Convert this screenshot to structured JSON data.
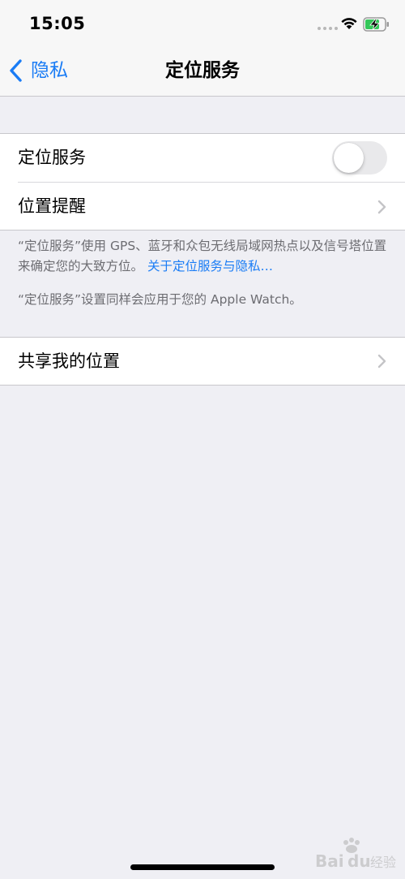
{
  "status_bar": {
    "time": "15:05",
    "icons": [
      "signal-dots-icon",
      "wifi-icon",
      "battery-charging-icon"
    ],
    "battery_color": "#34c759"
  },
  "nav": {
    "back_label": "隐私",
    "title": "定位服务",
    "accent_color": "#1a7cf5"
  },
  "settings": {
    "location_services": {
      "label": "定位服务",
      "toggle_on": false
    },
    "location_alerts": {
      "label": "位置提醒"
    },
    "footer_1": {
      "text": "“定位服务”使用 GPS、蓝牙和众包无线局域网热点以及信号塔位置来确定您的大致方位。",
      "link": "关于定位服务与隐私…"
    },
    "footer_2": {
      "text": "“定位服务”设置同样会应用于您的 Apple Watch。"
    },
    "share_location": {
      "label": "共享我的位置"
    }
  },
  "watermark": {
    "text": "Bai du 经验"
  }
}
